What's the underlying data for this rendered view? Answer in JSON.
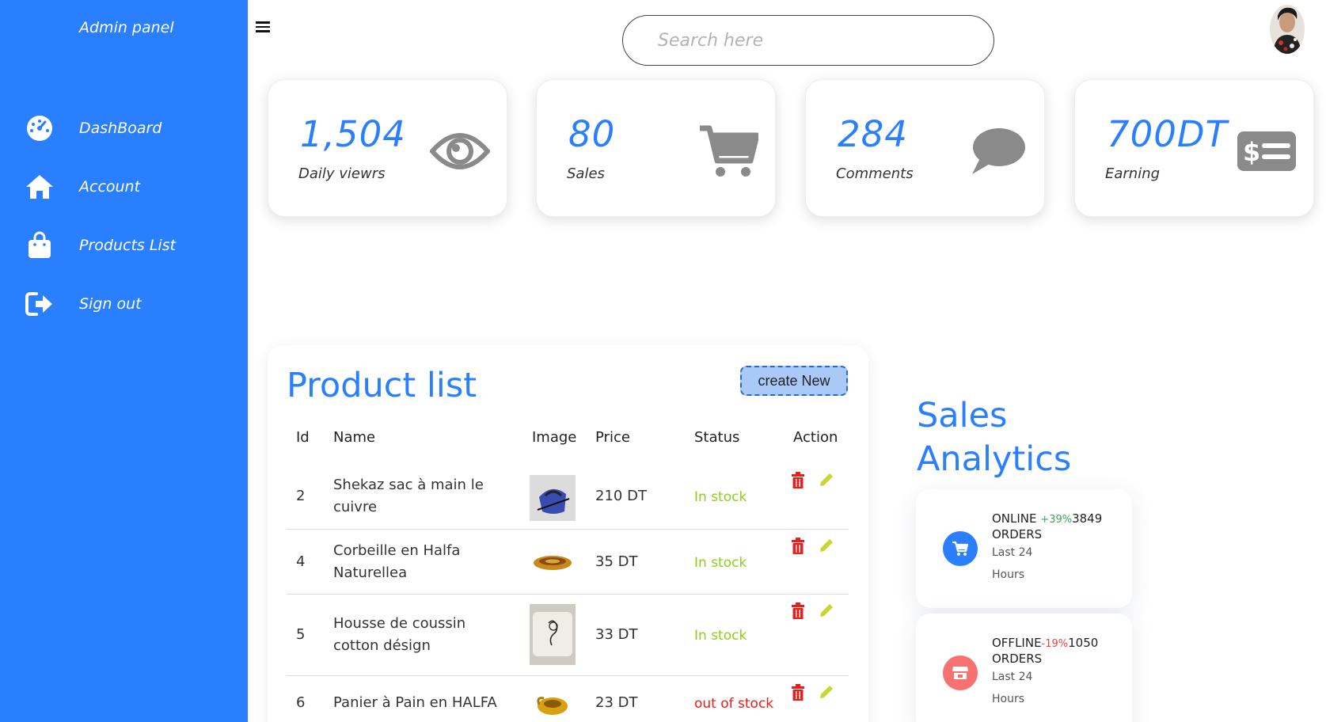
{
  "sidebar": {
    "brand": "Admin panel",
    "items": [
      {
        "label": "DashBoard",
        "icon": "dashboard-icon"
      },
      {
        "label": "Account",
        "icon": "home-icon"
      },
      {
        "label": "Products List",
        "icon": "shopping-bag-icon"
      },
      {
        "label": "Sign out",
        "icon": "sign-out-icon"
      }
    ]
  },
  "search": {
    "placeholder": "Search here"
  },
  "cards": [
    {
      "value": "1,504",
      "label": "Daily viewrs",
      "icon": "eye-icon"
    },
    {
      "value": "80",
      "label": "Sales",
      "icon": "cart-icon"
    },
    {
      "value": "284",
      "label": "Comments",
      "icon": "comment-icon"
    },
    {
      "value": "700DT",
      "label": "Earning",
      "icon": "money-bill-icon"
    }
  ],
  "products": {
    "title": "Product list",
    "create_label": "create New",
    "headers": {
      "id": "Id",
      "name": "Name",
      "image": "Image",
      "price": "Price",
      "status": "Status",
      "action": "Action"
    },
    "rows": [
      {
        "id": "2",
        "name": "Shekaz sac à main le cuivre",
        "price": "210 DT",
        "status": "In stock"
      },
      {
        "id": "4",
        "name": "Corbeille en Halfa Naturellea",
        "price": "35 DT",
        "status": "In stock"
      },
      {
        "id": "5",
        "name": "Housse de coussin cotton désign",
        "price": "33 DT",
        "status": "In stock"
      },
      {
        "id": "6",
        "name": "Panier à Pain en HALFA",
        "price": "23 DT",
        "status": "out of stock"
      }
    ]
  },
  "analytics": {
    "title_line1": "Sales",
    "title_line2": "Analytics",
    "items": [
      {
        "label": "ONLINE",
        "change": "+39%",
        "value": "3849",
        "unit": "ORDERS",
        "sub1": "Last 24",
        "sub2": "Hours",
        "change_color": "#3aa655",
        "icon": "cart-icon",
        "icon_bg": "#2a7fff"
      },
      {
        "label": "OFFLINE",
        "change": "-19%",
        "value": "1050",
        "unit": "ORDERS",
        "sub1": "Last 24",
        "sub2": "Hours",
        "change_color": "#ef4444",
        "icon": "store-icon",
        "icon_bg": "#f87171"
      }
    ]
  },
  "colors": {
    "accent": "#2a7fff",
    "in_stock": "#8ccf1a",
    "out_of_stock": "#ef1c1c",
    "delete": "#ef1c1c",
    "edit": "#c9d631"
  }
}
